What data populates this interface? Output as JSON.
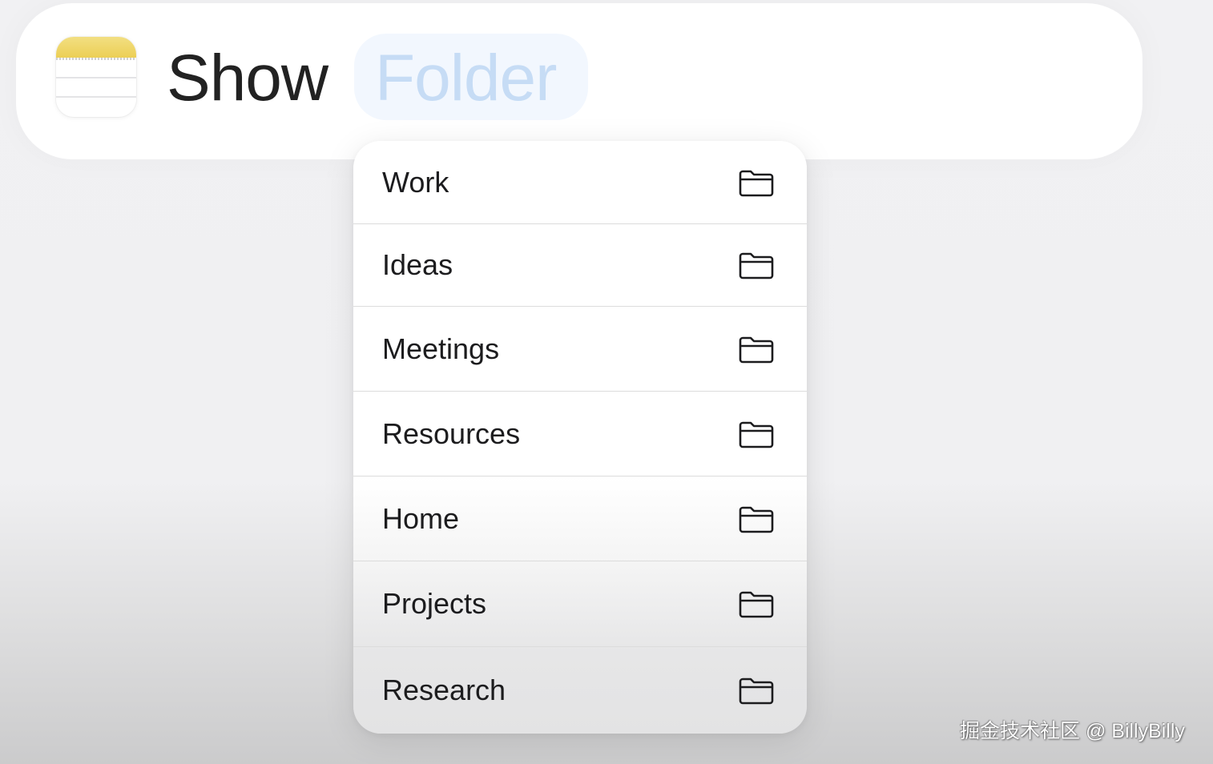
{
  "header": {
    "app_icon": "notes-app-icon",
    "action_label": "Show",
    "parameter_label": "Folder"
  },
  "menu": {
    "items": [
      {
        "label": "Work",
        "icon": "folder-icon"
      },
      {
        "label": "Ideas",
        "icon": "folder-icon"
      },
      {
        "label": "Meetings",
        "icon": "folder-icon"
      },
      {
        "label": "Resources",
        "icon": "folder-icon"
      },
      {
        "label": "Home",
        "icon": "folder-icon"
      },
      {
        "label": "Projects",
        "icon": "folder-icon"
      },
      {
        "label": "Research",
        "icon": "folder-icon"
      }
    ]
  },
  "watermark": "掘金技术社区 @ BillyBilly",
  "colors": {
    "notes_yellow": "#eccf55",
    "chip_background": "#f2f7fe",
    "chip_text": "#c6dcf5"
  }
}
